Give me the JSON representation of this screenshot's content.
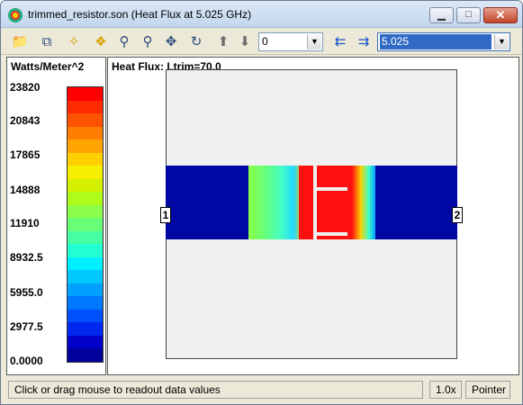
{
  "window": {
    "title": "trimmed_resistor.son (Heat Flux at 5.025 GHz)",
    "minimize_symbol": "▁",
    "maximize_symbol": "□",
    "close_symbol": "✕"
  },
  "toolbar": {
    "icons": [
      "open-icon",
      "copy-icon",
      "new-view-icon",
      "3d-view-icon",
      "zoom-in-icon",
      "zoom-out-icon",
      "pan-icon",
      "rotate-icon",
      "level-up-icon",
      "level-down-icon",
      "freq-prev-icon",
      "freq-next-icon"
    ],
    "level_value": "0",
    "frequency_value": "5.025"
  },
  "colorbar": {
    "units": "Watts/Meter^2",
    "tick_labels": [
      "23820",
      "20843",
      "17865",
      "14888",
      "11910",
      "8932.5",
      "5955.0",
      "2977.5",
      "0.0000"
    ],
    "colors_top_to_bottom": [
      "#ff0000",
      "#ff2a00",
      "#ff5200",
      "#ff7d00",
      "#ffa400",
      "#ffcf00",
      "#f5ef00",
      "#d2f000",
      "#aefc1a",
      "#8bff4a",
      "#68ff77",
      "#45ffa4",
      "#22ffd2",
      "#00f0ff",
      "#00c8ff",
      "#00a0ff",
      "#0078ff",
      "#0050ff",
      "#0028ee",
      "#0000c8",
      "#00009a"
    ]
  },
  "plot": {
    "title": "Heat Flux: Ltrim=70.0",
    "port_left": "1",
    "port_right": "2",
    "colors": {
      "cold": "#0008a4",
      "hot": "#ff1010",
      "substrate": "#f0f0f0"
    }
  },
  "status": {
    "message": "Click or drag mouse to readout data values",
    "zoom": "1.0x",
    "mode": "Pointer"
  }
}
